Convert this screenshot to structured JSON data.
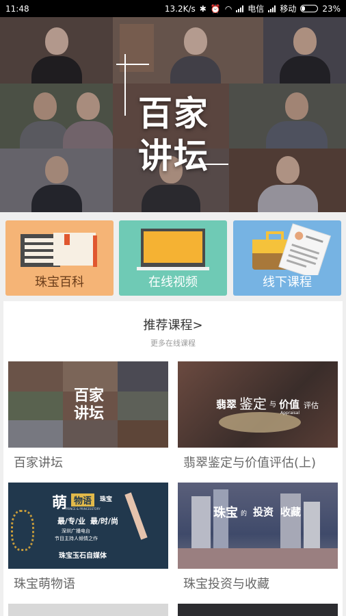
{
  "status_bar": {
    "time": "11:48",
    "net_speed": "13.2K/s",
    "carrier1": "电信",
    "carrier2": "移动",
    "battery": "23%",
    "battery_level": 0.23
  },
  "banner": {
    "title_line1": "百家",
    "title_line2": "讲坛"
  },
  "categories": [
    {
      "label": "珠宝百科",
      "color": "#f5b476"
    },
    {
      "label": "在线视频",
      "color": "#6fcab5"
    },
    {
      "label": "线下课程",
      "color": "#76b3e3"
    }
  ],
  "recommended": {
    "title": "推荐课程>",
    "subtitle": "更多在线课程",
    "courses": [
      {
        "title": "百家讲坛",
        "thumb_text": "百家讲坛"
      },
      {
        "title": "翡翠鉴定与价值评估(上)",
        "thumb_text1": "翡翠",
        "thumb_text2": "鉴定",
        "thumb_text3": "与",
        "thumb_text4": "价值",
        "thumb_text5": "评估",
        "thumb_text6": "Appraisal"
      },
      {
        "title": "珠宝萌物语",
        "thumb_text1": "萌",
        "thumb_text2": "物语",
        "thumb_text3": "珠宝",
        "thumb_text4": "最/专/业",
        "thumb_text5": "最/时/尚",
        "thumb_text6": "PRINCE & PRINCESSTORY",
        "thumb_text7": "深圳广播电台",
        "thumb_text8": "节目主持人倾情之作",
        "thumb_text9": "珠宝玉石自媒体"
      },
      {
        "title": "珠宝投资与收藏",
        "thumb_text1": "珠宝",
        "thumb_text2": "的",
        "thumb_text3": "投资",
        "thumb_text4": "收藏"
      }
    ]
  },
  "colors": {
    "orange": "#f5b476",
    "teal": "#6fcab5",
    "blue": "#76b3e3"
  }
}
